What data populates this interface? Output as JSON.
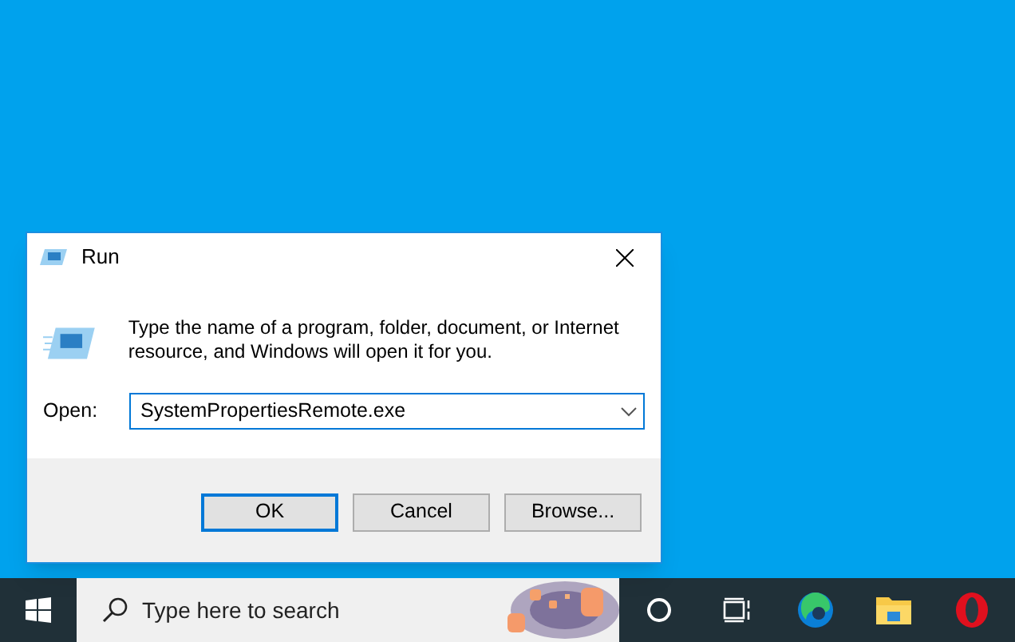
{
  "dialog": {
    "title": "Run",
    "description": "Type the name of a program, folder, document, or Internet resource, and Windows will open it for you.",
    "open_label": "Open:",
    "open_value": "SystemPropertiesRemote.exe",
    "buttons": [
      {
        "label": "OK",
        "default": true
      },
      {
        "label": "Cancel",
        "default": false
      },
      {
        "label": "Browse...",
        "default": false
      }
    ]
  },
  "taskbar": {
    "search": {
      "placeholder": "Type here to search"
    },
    "apps": [
      {
        "kind": "cortana"
      },
      {
        "kind": "taskview"
      },
      {
        "kind": "edge"
      },
      {
        "kind": "explorer"
      },
      {
        "kind": "opera"
      }
    ]
  }
}
